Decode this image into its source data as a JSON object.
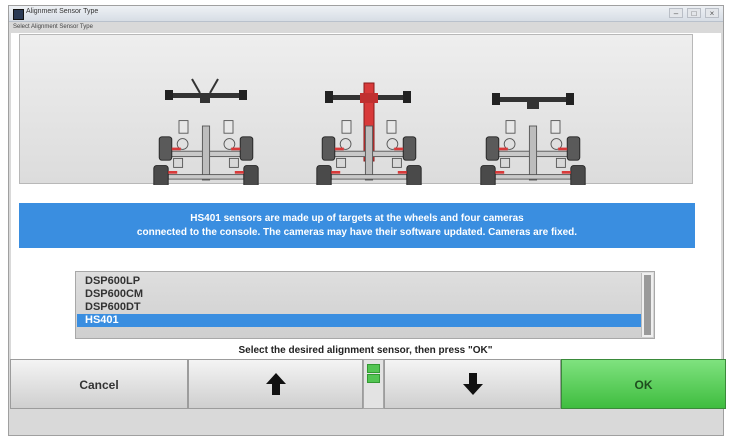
{
  "window": {
    "title": "Alignment Sensor Type",
    "subtitle": "Select Alignment Sensor Type"
  },
  "window_controls": {
    "minimize": "–",
    "maximize": "□",
    "close": "×"
  },
  "info_banner": {
    "line1": "HS401 sensors are made up of targets at the wheels and four cameras",
    "line2": "connected to the console. The cameras may have their software updated.  Cameras are fixed."
  },
  "sensor_list": {
    "items": [
      "DSP600LP",
      "DSP600CM",
      "DSP600DT",
      "HS401"
    ],
    "selected": "HS401"
  },
  "status": {
    "text": "Select the desired alignment sensor, then press \"OK\""
  },
  "buttons": {
    "cancel": "Cancel",
    "up_icon": "up-arrow-icon",
    "down_icon": "down-arrow-icon",
    "ok": "OK"
  },
  "colors": {
    "accent_blue": "#3a8ee0",
    "ok_green": "#4ccc4c",
    "highlight_red": "#d83a3a"
  }
}
